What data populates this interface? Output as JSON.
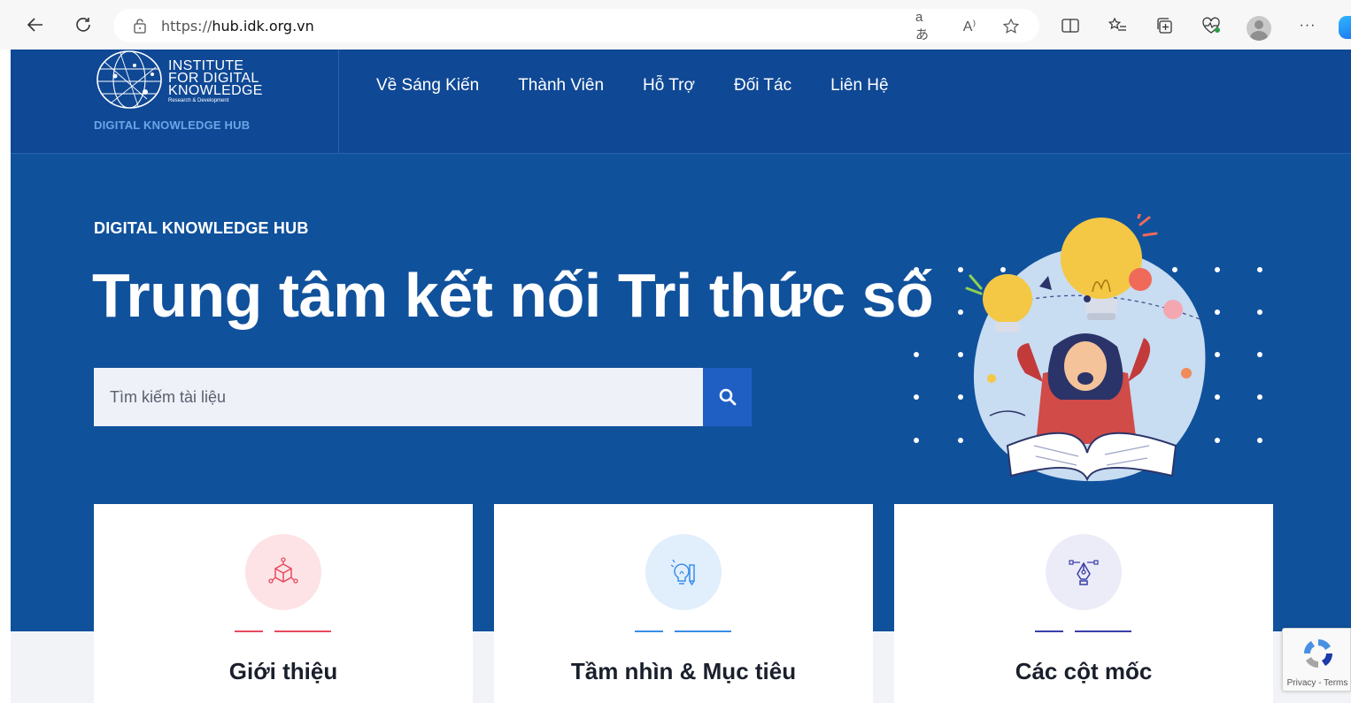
{
  "browser": {
    "url_prefix": "https://",
    "url_host": "hub.idk.org.vn",
    "icons": [
      "back-arrow-icon",
      "refresh-icon",
      "lock-icon",
      "translate-icon",
      "read-aloud-icon",
      "favorite-star-icon",
      "split-screen-icon",
      "favorites-list-icon",
      "collections-icon",
      "browser-essentials-icon",
      "profile-avatar",
      "more-menu-icon",
      "copilot-icon"
    ],
    "translate_glyph": "aあ",
    "read_aloud_glyph": "A⁾",
    "more_glyph": "···"
  },
  "logo": {
    "line1": "INSTITUTE",
    "line2": "FOR DIGITAL",
    "line3": "KNOWLEDGE",
    "line4": "Research & Development",
    "subtitle": "DIGITAL KNOWLEDGE HUB"
  },
  "menu": {
    "items": [
      {
        "label": "Về Sáng Kiến"
      },
      {
        "label": "Thành Viên"
      },
      {
        "label": "Hỗ Trợ"
      },
      {
        "label": "Đối Tác"
      },
      {
        "label": "Liên Hệ"
      }
    ]
  },
  "hero": {
    "eyebrow": "DIGITAL KNOWLEDGE HUB",
    "title": "Trung tâm kết nối Tri thức số",
    "search_placeholder": "Tìm kiếm tài liệu",
    "search_icon": "search-icon"
  },
  "cards": [
    {
      "title": "Giới thiệu",
      "icon": "cube-network-icon",
      "accent": "#e84a5f",
      "icon_bg": "#fde3e6"
    },
    {
      "title": "Tầm nhìn & Mục tiêu",
      "icon": "idea-pencil-icon",
      "accent": "#3a8ee6",
      "icon_bg": "#e1eefc"
    },
    {
      "title": "Các cột mốc",
      "icon": "pen-tool-icon",
      "accent": "#3a3fa8",
      "icon_bg": "#ecebf8"
    }
  ],
  "colors": {
    "header_bg": "#0f4895",
    "hero_bg": "#10519c",
    "search_button": "#1f5fc4"
  },
  "recaptcha": {
    "text": "Privacy - Terms"
  }
}
